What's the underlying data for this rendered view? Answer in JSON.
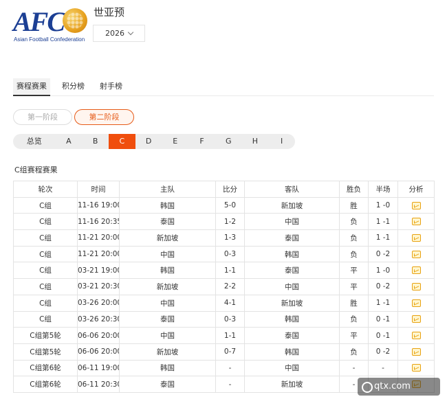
{
  "header": {
    "logo_text": "AFC",
    "logo_sub": "Asian Football Confederation",
    "title": "世亚预",
    "year": "2026"
  },
  "main_tabs": [
    "赛程赛果",
    "积分榜",
    "射手榜"
  ],
  "stages": [
    "第一阶段",
    "第二阶段"
  ],
  "groups": [
    "总览",
    "A",
    "B",
    "C",
    "D",
    "E",
    "F",
    "G",
    "H",
    "I"
  ],
  "section_title": "C组赛程赛果",
  "table": {
    "headers": [
      "轮次",
      "时间",
      "主队",
      "比分",
      "客队",
      "胜负",
      "半场",
      "分析"
    ],
    "rows": [
      [
        "C组",
        "11-16 19:00",
        "韩国",
        "5-0",
        "新加坡",
        "胜",
        "1 -0"
      ],
      [
        "C组",
        "11-16 20:35",
        "泰国",
        "1-2",
        "中国",
        "负",
        "1 -1"
      ],
      [
        "C组",
        "11-21 20:00",
        "新加坡",
        "1-3",
        "泰国",
        "负",
        "1 -1"
      ],
      [
        "C组",
        "11-21 20:00",
        "中国",
        "0-3",
        "韩国",
        "负",
        "0 -2"
      ],
      [
        "C组",
        "03-21 19:00",
        "韩国",
        "1-1",
        "泰国",
        "平",
        "1 -0"
      ],
      [
        "C组",
        "03-21 20:30",
        "新加坡",
        "2-2",
        "中国",
        "平",
        "0 -2"
      ],
      [
        "C组",
        "03-26 20:00",
        "中国",
        "4-1",
        "新加坡",
        "胜",
        "1 -1"
      ],
      [
        "C组",
        "03-26 20:30",
        "泰国",
        "0-3",
        "韩国",
        "负",
        "0 -1"
      ],
      [
        "C组第5轮",
        "06-06 20:00",
        "中国",
        "1-1",
        "泰国",
        "平",
        "0 -1"
      ],
      [
        "C组第5轮",
        "06-06 20:00",
        "新加坡",
        "0-7",
        "韩国",
        "负",
        "0 -2"
      ],
      [
        "C组第6轮",
        "06-11 19:00",
        "韩国",
        "-",
        "中国",
        "-",
        "-"
      ],
      [
        "C组第6轮",
        "06-11 20:30",
        "泰国",
        "-",
        "新加坡",
        "-",
        "-"
      ]
    ]
  },
  "watermark": "qtx.com",
  "colors": {
    "accent": "#f04e0d",
    "logo_blue": "#1c3f94",
    "icon_yellow": "#e8a10f"
  }
}
